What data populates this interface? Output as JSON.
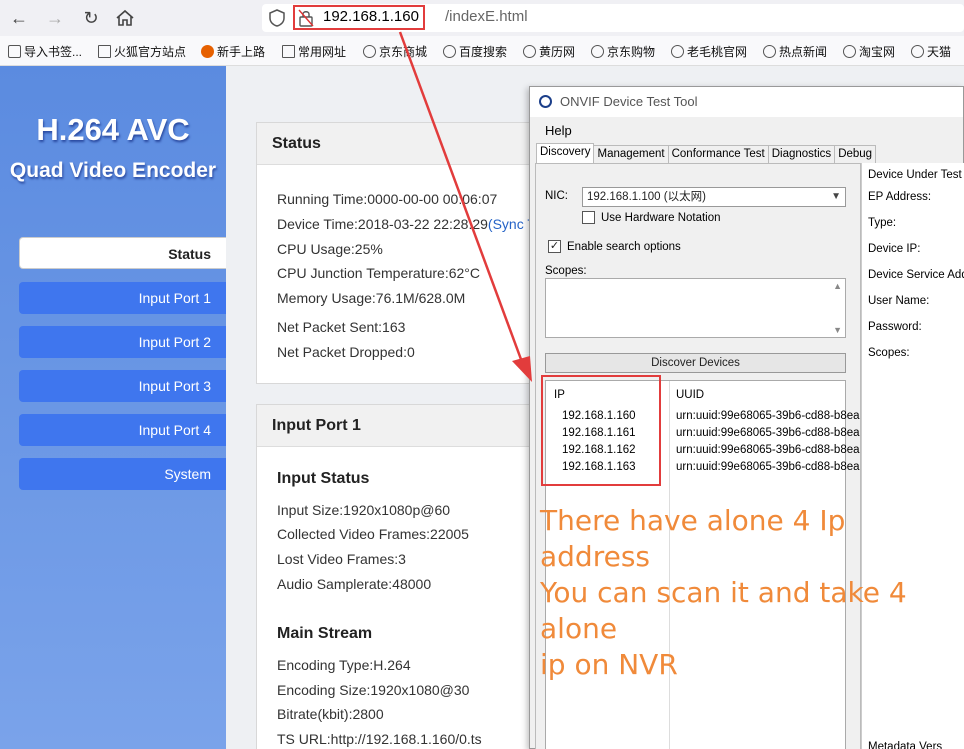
{
  "browser": {
    "url_host": "192.168.1.160",
    "url_path": "/indexE.html",
    "bookmarks": [
      "导入书签...",
      "火狐官方站点",
      "新手上路",
      "常用网址",
      "京东商城",
      "百度搜索",
      "黄历网",
      "京东购物",
      "老毛桃官网",
      "热点新闻",
      "淘宝网",
      "天猫"
    ]
  },
  "sidebar": {
    "brand_line1": "H.264 AVC",
    "brand_line2": "Quad Video Encoder",
    "items": [
      {
        "label": "Status",
        "active": true
      },
      {
        "label": "Input Port 1"
      },
      {
        "label": "Input Port 2"
      },
      {
        "label": "Input Port 3"
      },
      {
        "label": "Input Port 4"
      },
      {
        "label": "System"
      }
    ]
  },
  "status": {
    "title": "Status",
    "running_time": "Running Time:0000-00-00 00:06:07",
    "device_time": "Device Time:2018-03-22 22:28:29",
    "sync_link": "(Sync Ti",
    "cpu_usage": "CPU Usage:25%",
    "cpu_temp": "CPU Junction Temperature:62°C",
    "memory": "Memory Usage:76.1M/628.0M",
    "packet_sent": "Net Packet Sent:163",
    "packet_dropped": "Net Packet Dropped:0"
  },
  "input_port": {
    "title": "Input Port 1",
    "input_status_heading": "Input Status",
    "input_size": "Input Size:1920x1080p@60",
    "collected_frames": "Collected Video Frames:22005",
    "lost_frames": "Lost Video Frames:3",
    "audio_samplerate": "Audio Samplerate:48000",
    "main_stream_heading": "Main Stream",
    "encoding_type": "Encoding Type:H.264",
    "encoding_size": "Encoding Size:1920x1080@30",
    "bitrate": "Bitrate(kbit):2800",
    "ts_url": "TS URL:http://192.168.1.160/0.ts"
  },
  "onvif": {
    "title": "ONVIF Device Test Tool",
    "menu_help": "Help",
    "tabs": [
      "Discovery",
      "Management",
      "Conformance Test",
      "Diagnostics",
      "Debug"
    ],
    "nic_label": "NIC:",
    "nic_value": "192.168.1.100 (以太网)",
    "hw_notation": "Use Hardware Notation",
    "search_options": "Enable search options",
    "scopes_label": "Scopes:",
    "discover_button": "Discover Devices",
    "col_ip": "IP",
    "col_uuid": "UUID",
    "devices": [
      {
        "ip": "192.168.1.160",
        "uuid": "urn:uuid:99e68065-39b6-cd88-b8ea"
      },
      {
        "ip": "192.168.1.161",
        "uuid": "urn:uuid:99e68065-39b6-cd88-b8ea"
      },
      {
        "ip": "192.168.1.162",
        "uuid": "urn:uuid:99e68065-39b6-cd88-b8ea"
      },
      {
        "ip": "192.168.1.163",
        "uuid": "urn:uuid:99e68065-39b6-cd88-b8ea"
      }
    ],
    "dut_title": "Device Under Test In",
    "dut_fields": [
      "EP Address:",
      "Type:",
      "Device IP:",
      "Device Service Addr",
      "User Name:",
      "Password:",
      "Scopes:"
    ],
    "dut_bottom": "Metadata Vers"
  },
  "annotation": {
    "line1": "There have alone 4 Ip address",
    "line2": "You can scan it and take 4 alone",
    "line3": "ip on NVR"
  },
  "colors": {
    "accent_blue": "#3f76ee",
    "highlight_red": "#e23c3c",
    "annotation_orange": "#f08a3a"
  }
}
